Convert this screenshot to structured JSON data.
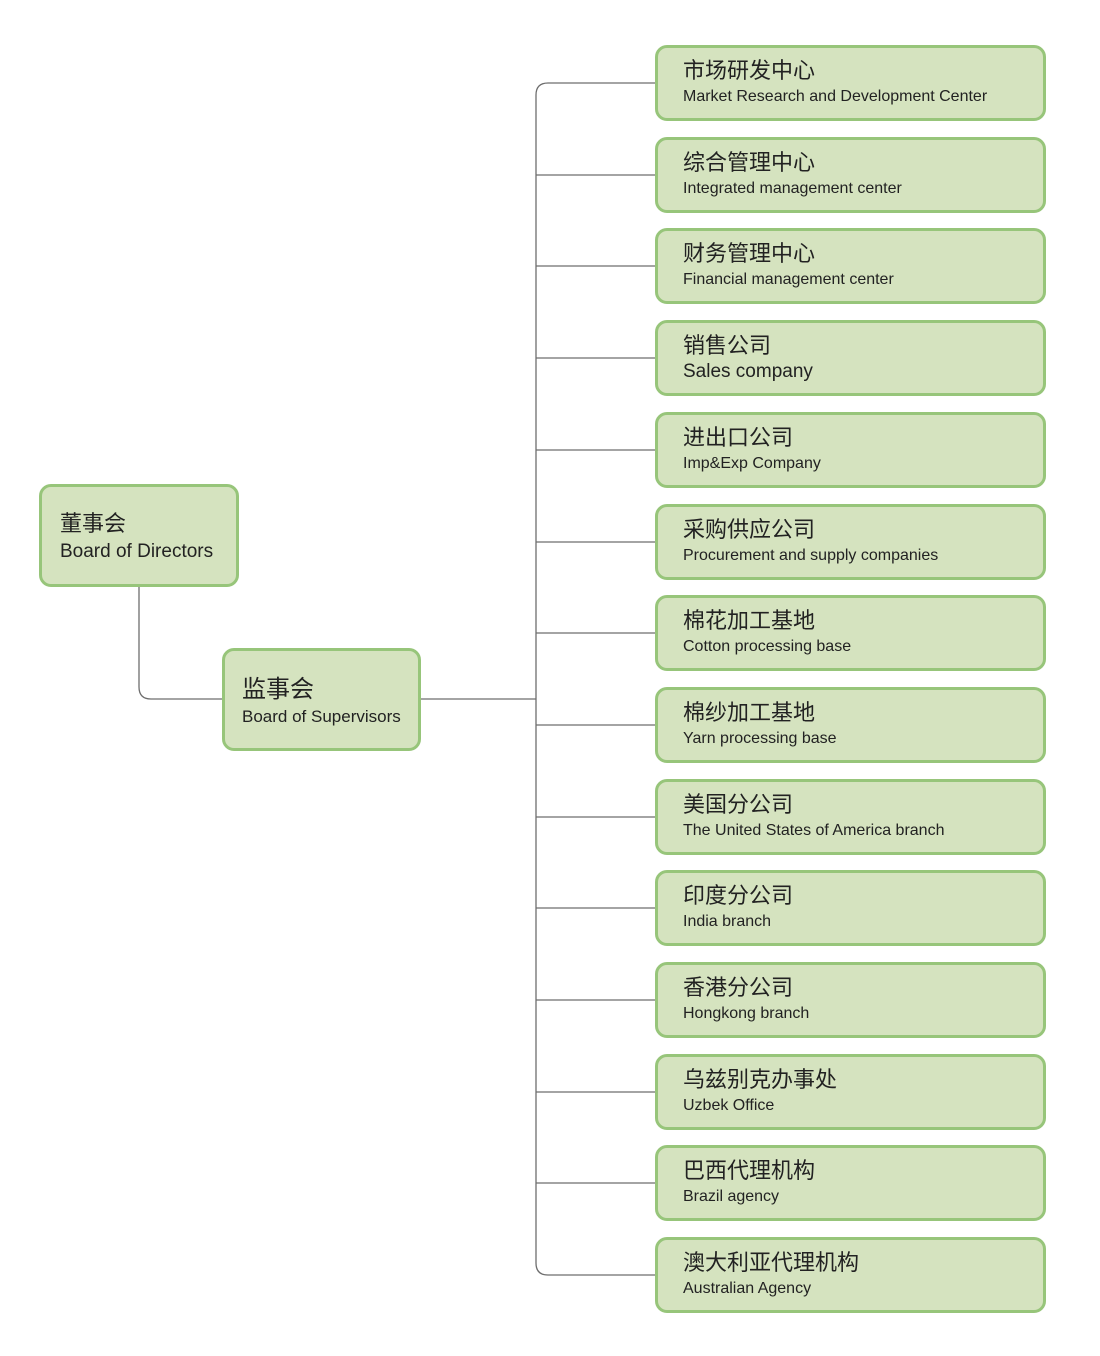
{
  "root": {
    "zh": "董事会",
    "en": "Board of Directors"
  },
  "supervisors": {
    "zh": "监事会",
    "en": "Board of Supervisors"
  },
  "departments": [
    {
      "zh": "市场研发中心",
      "en": "Market Research and Development Center"
    },
    {
      "zh": "综合管理中心",
      "en": "Integrated management center"
    },
    {
      "zh": "财务管理中心",
      "en": "Financial management center"
    },
    {
      "zh": "销售公司",
      "en": "Sales company"
    },
    {
      "zh": "进出口公司",
      "en": "Imp&Exp Company"
    },
    {
      "zh": "采购供应公司",
      "en": "Procurement and supply companies"
    },
    {
      "zh": "棉花加工基地",
      "en": "Cotton processing base"
    },
    {
      "zh": "棉纱加工基地",
      "en": "Yarn processing base"
    },
    {
      "zh": "美国分公司",
      "en": "The United States of America branch"
    },
    {
      "zh": "印度分公司",
      "en": "India branch"
    },
    {
      "zh": "香港分公司",
      "en": "Hongkong branch"
    },
    {
      "zh": "乌兹别克办事处",
      "en": "Uzbek Office"
    },
    {
      "zh": "巴西代理机构",
      "en": "Brazil agency"
    },
    {
      "zh": "澳大利亚代理机构",
      "en": "Australian Agency"
    }
  ],
  "colors": {
    "node_fill": "#d5e3bf",
    "node_border": "#97c57a",
    "connector": "#6e6e6e"
  }
}
